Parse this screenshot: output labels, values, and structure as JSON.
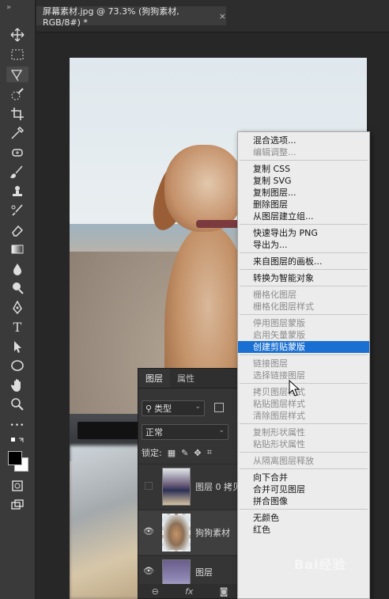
{
  "document": {
    "tab_title": "屏幕素材.jpg @ 73.3% (狗狗素材, RGB/8#) *",
    "close_glyph": "×"
  },
  "toolbar": {
    "grip": "»",
    "tools": [
      "move-icon",
      "marquee-icon",
      "lasso-icon",
      "quick-select-icon",
      "crop-icon",
      "eyedropper-icon",
      "healing-icon",
      "brush-icon",
      "stamp-icon",
      "history-brush-icon",
      "eraser-icon",
      "gradient-icon",
      "blur-icon",
      "dodge-icon",
      "pen-icon",
      "type-icon",
      "path-select-icon",
      "ellipse-icon",
      "hand-icon",
      "zoom-icon",
      "more-icon",
      "quick-mask-icon",
      "screen-mode-icon"
    ],
    "type_tool_glyph": "T",
    "more_glyph": "•••"
  },
  "layers_panel": {
    "tabs": [
      "图层",
      "属性"
    ],
    "filter_label": "类型",
    "blend_mode": "正常",
    "lock_label": "锁定:",
    "layers": [
      {
        "name": "图层 0 拷贝",
        "visible": false
      },
      {
        "name": "狗狗素材",
        "visible": true
      },
      {
        "name": "图层",
        "visible": true
      }
    ],
    "bottom_icons": [
      "link-icon",
      "fx-icon",
      "mask-icon"
    ],
    "fx_label": "fx"
  },
  "context_menu": {
    "items": [
      {
        "label": "混合选项...",
        "disabled": false
      },
      {
        "label": "编辑调整...",
        "disabled": true
      },
      {
        "sep": true
      },
      {
        "label": "复制 CSS",
        "disabled": false
      },
      {
        "label": "复制 SVG",
        "disabled": false
      },
      {
        "label": "复制图层...",
        "disabled": false
      },
      {
        "label": "删除图层",
        "disabled": false
      },
      {
        "label": "从图层建立组...",
        "disabled": false
      },
      {
        "sep": true
      },
      {
        "label": "快速导出为 PNG",
        "disabled": false
      },
      {
        "label": "导出为...",
        "disabled": false
      },
      {
        "sep": true
      },
      {
        "label": "来自图层的画板...",
        "disabled": false
      },
      {
        "sep": true
      },
      {
        "label": "转换为智能对象",
        "disabled": false
      },
      {
        "sep": true
      },
      {
        "label": "栅格化图层",
        "disabled": true
      },
      {
        "label": "栅格化图层样式",
        "disabled": true
      },
      {
        "sep": true
      },
      {
        "label": "停用图层蒙版",
        "disabled": true
      },
      {
        "label": "启用矢量蒙版",
        "disabled": true
      },
      {
        "label": "创建剪贴蒙版",
        "disabled": false,
        "highlighted": true
      },
      {
        "sep": true
      },
      {
        "label": "链接图层",
        "disabled": true
      },
      {
        "label": "选择链接图层",
        "disabled": true
      },
      {
        "sep": true
      },
      {
        "label": "拷贝图层样式",
        "disabled": true
      },
      {
        "label": "粘贴图层样式",
        "disabled": true
      },
      {
        "label": "清除图层样式",
        "disabled": true
      },
      {
        "sep": true
      },
      {
        "label": "复制形状属性",
        "disabled": true
      },
      {
        "label": "粘贴形状属性",
        "disabled": true
      },
      {
        "sep": true
      },
      {
        "label": "从隔离图层释放",
        "disabled": true
      },
      {
        "sep": true
      },
      {
        "label": "向下合并",
        "disabled": false
      },
      {
        "label": "合并可见图层",
        "disabled": false
      },
      {
        "label": "拼合图像",
        "disabled": false
      },
      {
        "sep": true
      },
      {
        "label": "无颜色",
        "disabled": false
      },
      {
        "label": "红色",
        "disabled": false
      }
    ]
  },
  "watermark": "Bai经验",
  "colors": {
    "highlight": "#1a70d2",
    "menu_bg": "#ececec",
    "panel_bg": "#353535"
  }
}
